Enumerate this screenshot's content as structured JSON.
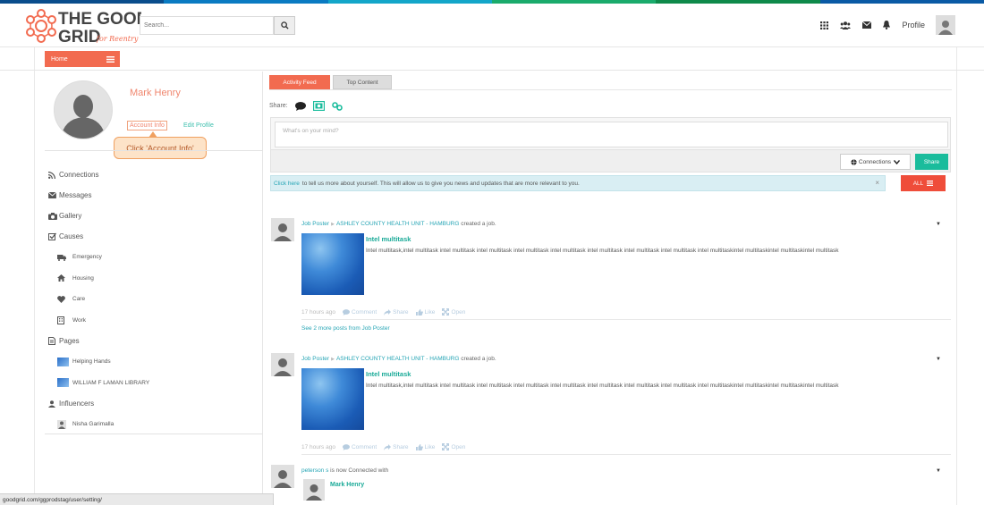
{
  "colors": {
    "accent": "#f26b50",
    "teal": "#1abc9c",
    "link": "#26a5b5",
    "stripe": [
      "#0a4d8c",
      "#0a7bc2",
      "#13a6c9",
      "#1aab6c",
      "#0e8a4a",
      "#0a5aa5"
    ]
  },
  "header": {
    "logo_line1": "THE GOOD",
    "logo_line2": "GRID",
    "logo_tagline": "for Reentry",
    "search_placeholder": "Search...",
    "profile_label": "Profile",
    "icons": [
      "apps-grid-icon",
      "users-icon",
      "envelope-icon",
      "bell-icon"
    ]
  },
  "nav": {
    "home_label": "Home"
  },
  "profile": {
    "name": "Mark Henry",
    "account_info": "Account Info",
    "edit_profile": "Edit Profile",
    "callout": "Click 'Account Info'"
  },
  "menu": {
    "connections": "Connections",
    "messages": "Messages",
    "gallery": "Gallery",
    "causes": "Causes",
    "causes_items": [
      "Emergency",
      "Housing",
      "Care",
      "Work"
    ],
    "pages": "Pages",
    "pages_items": [
      "Helping Hands",
      "WILLIAM F LAMAN LIBRARY"
    ],
    "influencers": "Influencers",
    "influencer_items": [
      "Nisha Garimalla"
    ]
  },
  "feed": {
    "tabs": [
      "Activity Feed",
      "Top Content"
    ],
    "share_label": "Share:",
    "composer_placeholder": "What's on your mind?",
    "connections_dropdown": "Connections",
    "share_button": "Share",
    "notice_link": "Click here",
    "notice_text": "to tell us more about yourself. This will allow us to give you news and updates that are more relevant to you.",
    "notice_close": "×",
    "all_button": "ALL",
    "posts": [
      {
        "author": "Job Poster",
        "target": "ASHLEY COUNTY HEALTH UNIT - HAMBURG",
        "verb": "created a job.",
        "title": "Intel multitask",
        "body": "Intel multitask,intel multitask intel multitask intel multitask intel multitask intel multitask intel multitask intel multitask intel multitask  intel multitaskintel multitaskintel multitaskintel multitask",
        "time": "17 hours ago",
        "comment": "Comment",
        "share": "Share",
        "like": "Like",
        "open": "Open",
        "see_more": "See 2 more posts from Job Poster"
      },
      {
        "author": "Job Poster",
        "target": "ASHLEY COUNTY HEALTH UNIT - HAMBURG",
        "verb": "created a job.",
        "title": "Intel multitask",
        "body": "Intel multitask,intel multitask intel multitask intel multitask intel multitask intel multitask intel multitask intel multitask intel multitask  intel multitaskintel multitaskintel multitaskintel multitask",
        "time": "17 hours ago",
        "comment": "Comment",
        "share": "Share",
        "like": "Like",
        "open": "Open"
      }
    ],
    "connection_post": {
      "user": "peterson s",
      "text": "is now Connected with",
      "connected_name": "Mark Henry"
    }
  },
  "statusbar": "goodgrid.com/ggprodstag/user/setting/"
}
